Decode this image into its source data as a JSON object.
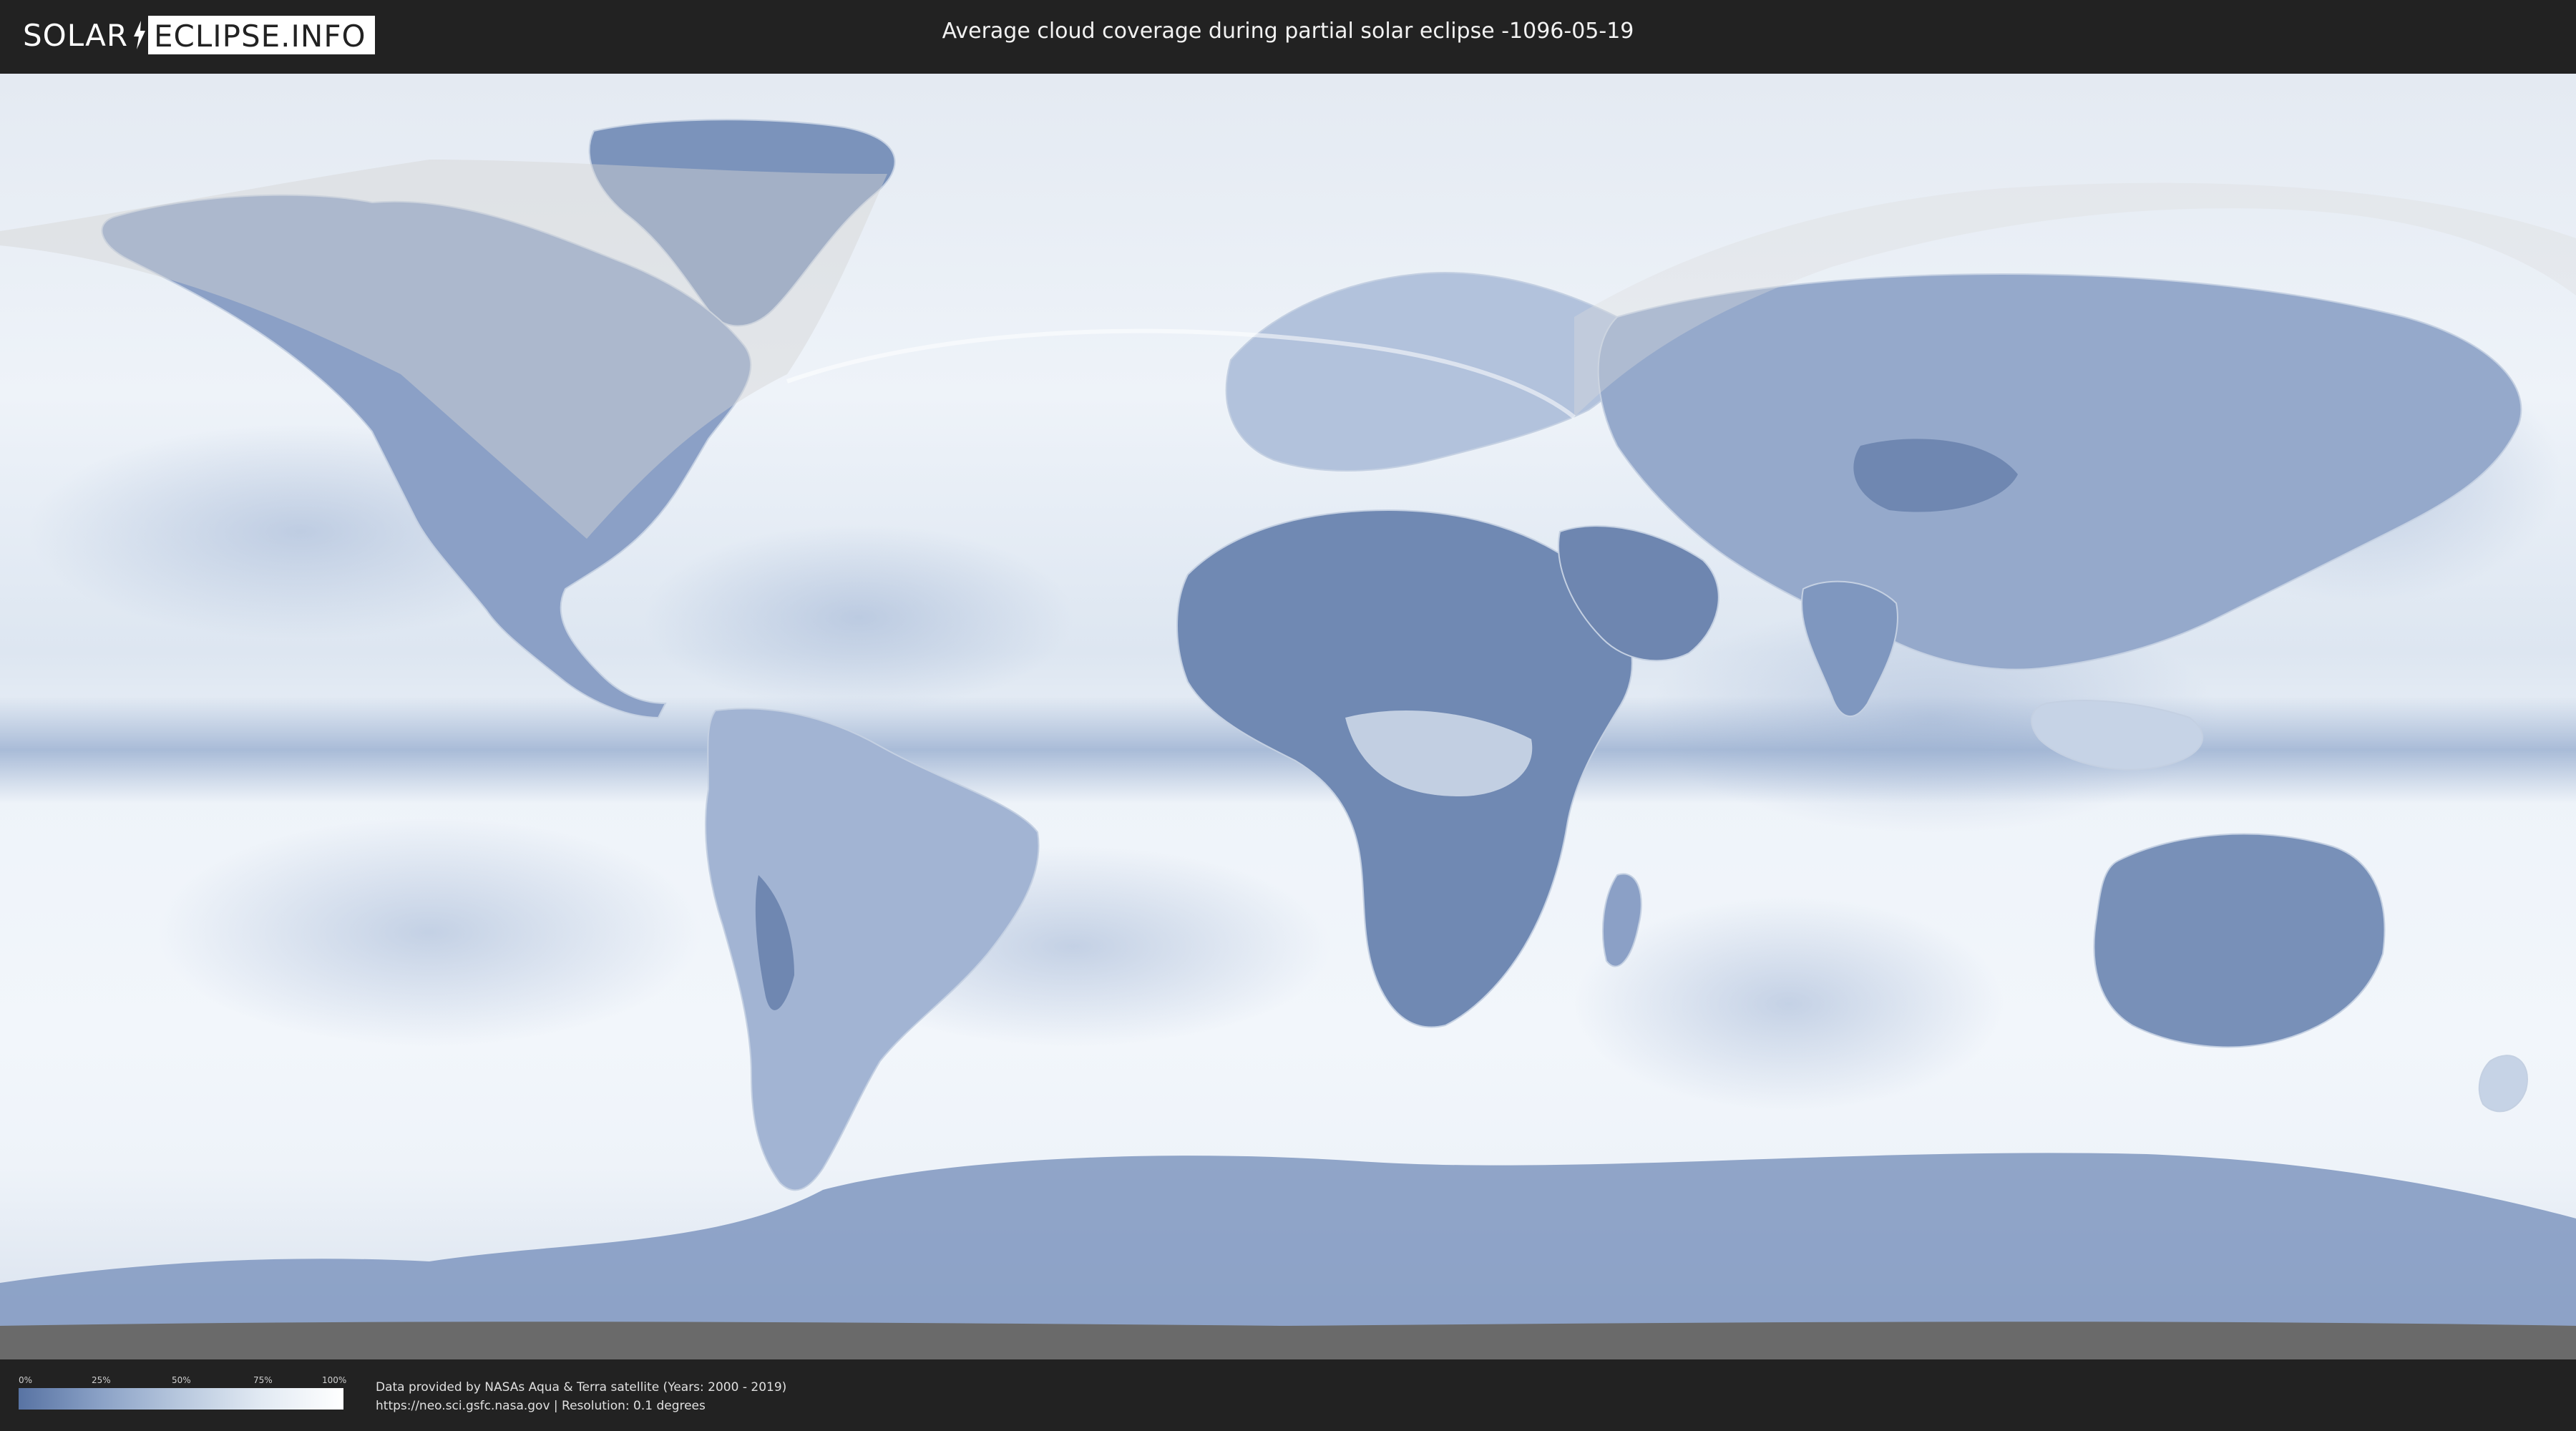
{
  "header": {
    "logo_left": "SOLAR",
    "logo_right": "ECLIPSE.INFO",
    "title": "Average cloud coverage during partial solar eclipse -1096-05-19"
  },
  "legend": {
    "ticks": [
      "0%",
      "25%",
      "50%",
      "75%",
      "100%"
    ],
    "colors": {
      "low": "#5873a3",
      "high": "#ffffff"
    }
  },
  "footer": {
    "credit_line1": "Data provided by NASAs Aqua & Terra satellite (Years: 2000 - 2019)",
    "credit_line2": "https://neo.sci.gsfc.nasa.gov | Resolution: 0.1 degrees"
  },
  "map": {
    "type": "world-map-equirectangular",
    "layer": "cloud-coverage",
    "colors": {
      "ocean_clear": "#f4f7fb",
      "land_cloudy": "#6e86b0",
      "band": "#93aacd",
      "eclipse_overlay": "#d8d8d8"
    }
  }
}
